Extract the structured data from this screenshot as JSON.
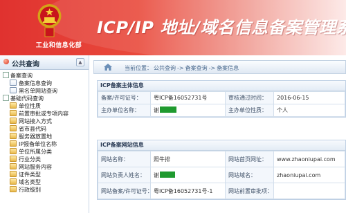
{
  "header": {
    "ministry": "工业和信息化部",
    "title": "ICP/IP 地址/域名信息备案管理系统",
    "colors": {
      "primary": "#e0322f",
      "accent": "#1f9a2f"
    }
  },
  "sidebar": {
    "title": "公共查询",
    "groups": [
      {
        "label": "备案查询",
        "items": [
          "备案信息查询",
          "黑名单网站查询"
        ]
      },
      {
        "label": "基础代码查询",
        "items": [
          "单位性质",
          "前置审批或专项内容",
          "网站接入方式",
          "省市县代码",
          "服务器放置地",
          "IP报备单位名称",
          "单位所属分类",
          "行业分类",
          "网站服务内容",
          "证件类型",
          "域名类型",
          "行政级别"
        ]
      }
    ]
  },
  "breadcrumb": {
    "label": "当前位置：",
    "parts": [
      "公共查询",
      "备案查询",
      "备案信息"
    ],
    "sep": "->"
  },
  "subject": {
    "title": "ICP备案主体信息",
    "license_label": "备案/许可证号：",
    "license_value": "粤ICP备16052731号",
    "date_label": "审核通过时间：",
    "date_value": "2016-06-15",
    "org_label": "主办单位名称：",
    "org_value": "谢",
    "nature_label": "主办单位性质：",
    "nature_value": "个人"
  },
  "website": {
    "title": "ICP备案网站信息",
    "name_label": "网站名称：",
    "name_value": "照牛排",
    "home_label": "网站首页网址：",
    "home_value": "www.zhaoniupai.com",
    "owner_label": "网站负责人姓名：",
    "owner_value": "谢",
    "domain_label": "网站域名：",
    "domain_value": "zhaoniupai.com",
    "license_label": "网站备案/许可证号：",
    "license_value": "粤ICP备16052731号-1",
    "approval_label": "网站前置审批项：",
    "approval_value": ""
  }
}
